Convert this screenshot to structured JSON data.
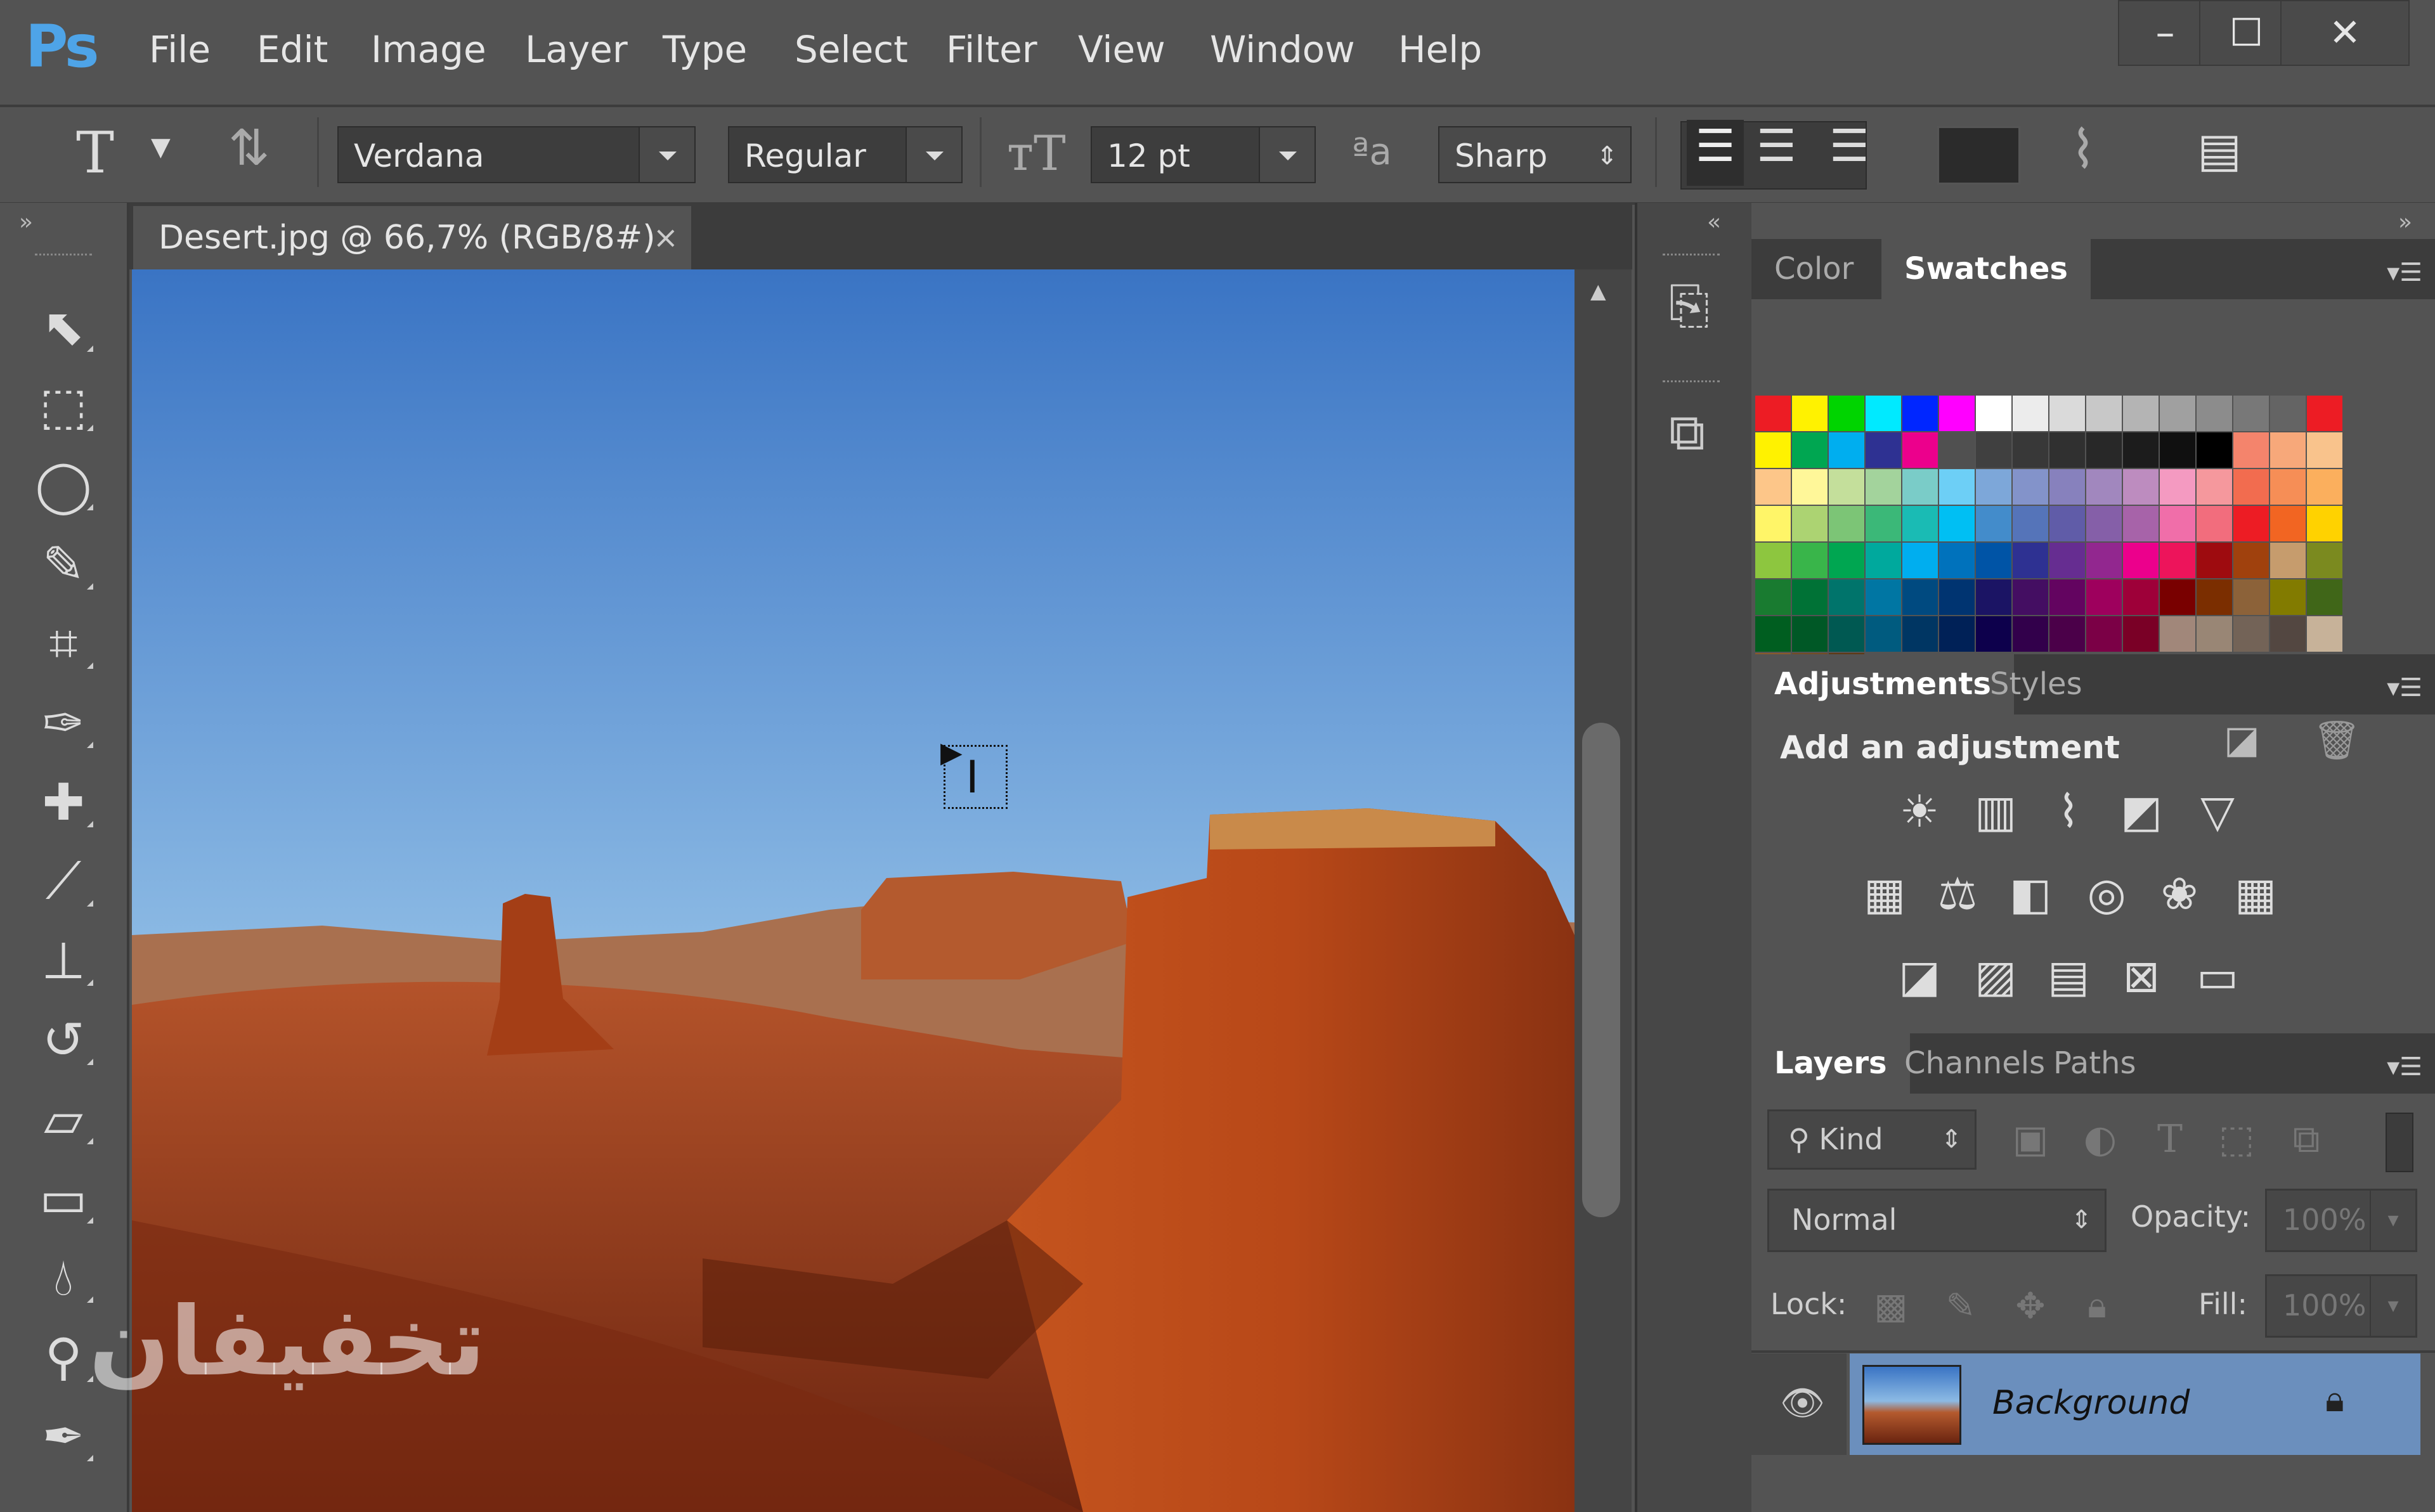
{
  "app": {
    "logo": "Ps"
  },
  "menu": [
    "File",
    "Edit",
    "Image",
    "Layer",
    "Type",
    "Select",
    "Filter",
    "View",
    "Window",
    "Help"
  ],
  "window_controls": {
    "minimize": "–",
    "maximize": "☐",
    "close": "✕"
  },
  "options_bar": {
    "font_family": "Verdana",
    "font_style": "Regular",
    "font_size": "12 pt",
    "antialias": "Sharp",
    "aa_label": "ªa"
  },
  "document": {
    "tab_title": "Desert.jpg @ 66,7% (RGB/8#)",
    "close": "×"
  },
  "watermark": "تخفیفان",
  "swatches_panel": {
    "tabs": [
      "Color",
      "Swatches"
    ],
    "active_tab": "Swatches"
  },
  "adjustments_panel": {
    "tabs": [
      "Adjustments",
      "Styles"
    ],
    "heading": "Add an adjustment"
  },
  "layers_panel": {
    "tabs": [
      "Layers",
      "Channels",
      "Paths"
    ],
    "kind_label": "Kind",
    "blend_mode": "Normal",
    "opacity_label": "Opacity:",
    "opacity_value": "100%",
    "lock_label": "Lock:",
    "fill_label": "Fill:",
    "fill_value": "100%",
    "layer_name": "Background"
  },
  "colors": {
    "accent": "#4ea4e8",
    "panel_bg": "#535353",
    "dark_bg": "#3c3c3c"
  },
  "swatch_rows": [
    [
      "#ed1c24",
      "#fff200",
      "#00d400",
      "#00eaff",
      "#0026ff",
      "#ff00ff",
      "#ffffff",
      "#ececec",
      "#dadada",
      "#c8c8c8",
      "#b4b4b4",
      "#a0a0a0",
      "#8c8c8c",
      "#787878",
      "#646464",
      "#ed1c24"
    ],
    [
      "#fff200",
      "#00a651",
      "#00aeef",
      "#2e3192",
      "#ec008c",
      "#505050",
      "#404040",
      "#383838",
      "#303030",
      "#282828",
      "#1c1c1c",
      "#101010",
      "#000000",
      "#f4846c",
      "#f7a87a",
      "#f9c38c"
    ],
    [
      "#fdc689",
      "#fff799",
      "#c4df9b",
      "#a3d39c",
      "#7accc8",
      "#6dcff6",
      "#7da7d9",
      "#8393ca",
      "#8781bd",
      "#a187be",
      "#bd8cbf",
      "#f49ac1",
      "#f5989d",
      "#f26c4f",
      "#f68e56",
      "#fbaf5d"
    ],
    [
      "#fff568",
      "#acd372",
      "#7cc576",
      "#3bb878",
      "#1abbb4",
      "#00bff3",
      "#438ccb",
      "#5574b9",
      "#605ca8",
      "#855fa8",
      "#a763a9",
      "#f06ea9",
      "#f26d7d",
      "#ed1c24",
      "#f26522",
      "#ffd200"
    ],
    [
      "#8dc63f",
      "#39b54a",
      "#00a651",
      "#00a99d",
      "#00aeef",
      "#0072bc",
      "#0054a6",
      "#2e3192",
      "#662d91",
      "#92278f",
      "#ec008c",
      "#ed145b",
      "#9e0b0f",
      "#a0410d",
      "#c69c6d",
      "#7b8a1f"
    ],
    [
      "#197b30",
      "#007236",
      "#00746b",
      "#0076a3",
      "#004a80",
      "#003471",
      "#1b1464",
      "#440e62",
      "#630460",
      "#9e005d",
      "#9e0039",
      "#790000",
      "#7b2e00",
      "#8c6239",
      "#827b00",
      "#406618"
    ],
    [
      "#005e20",
      "#005826",
      "#005952",
      "#005b7f",
      "#003663",
      "#002157",
      "#0d004c",
      "#32004b",
      "#4b0049",
      "#7b0046",
      "#7a0026",
      "#a1877a",
      "#998675",
      "#736357",
      "#534741",
      "#c7b299"
    ],
    [
      "#8b5a2b",
      "#754c24",
      "#603913"
    ]
  ]
}
